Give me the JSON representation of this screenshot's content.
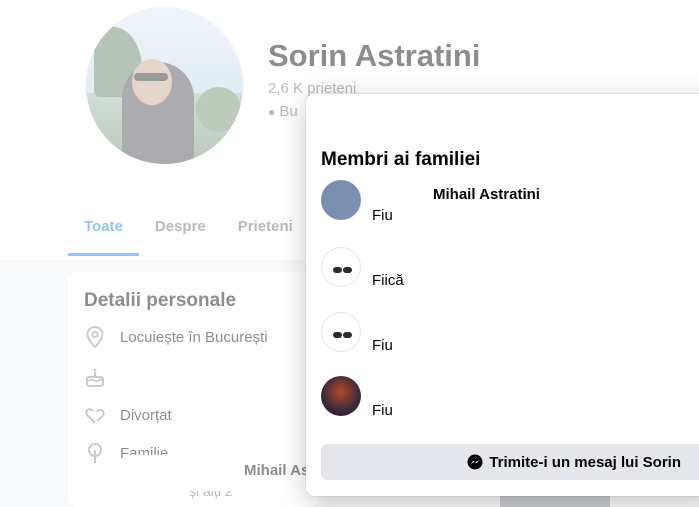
{
  "profile": {
    "name": "Sorin Astratini",
    "friends": "2,6 K prieteni",
    "location_short": "Bu"
  },
  "tabs": [
    {
      "label": "Toate",
      "active": true
    },
    {
      "label": "Despre",
      "active": false
    },
    {
      "label": "Prieteni",
      "active": false
    }
  ],
  "details": {
    "title": "Detalii personale",
    "lives_in": "Locuiește în București",
    "relationship": "Divorțat",
    "family_label": "Familie",
    "family_member_partial": "Mihail As",
    "family_more": "și alți 2"
  },
  "dialog": {
    "title": "Membri ai familiei",
    "first_member_name": "Mihail Astratini",
    "members": [
      {
        "relation": "Fiu",
        "avatar_color": "#7a8fb0"
      },
      {
        "relation": "Fiică",
        "avatar_color": "#2d2d33"
      },
      {
        "relation": "Fiu",
        "avatar_color": "#2d2d33"
      },
      {
        "relation": "Fiu",
        "avatar_color": "#3b2a3a"
      }
    ],
    "message_button": "Trimite-i un mesaj lui Sorin"
  },
  "colors": {
    "accent": "#1877f2",
    "secondary_text": "#65676b",
    "button_bg": "#e4e6eb"
  },
  "icons": {
    "location": "location-pin-icon",
    "birthday": "cake-icon",
    "relationship": "hearts-icon",
    "family": "tree-icon",
    "messenger": "messenger-icon"
  }
}
